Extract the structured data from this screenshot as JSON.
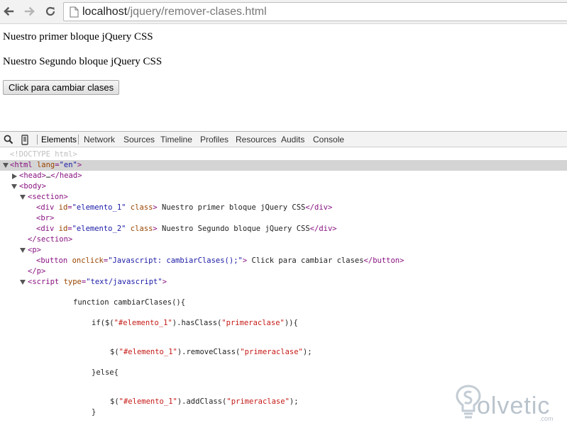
{
  "browser": {
    "url_host": "localhost",
    "url_path": "/jquery/remover-clases.html",
    "icons": [
      "back-icon",
      "forward-icon",
      "reload-icon",
      "page-icon"
    ]
  },
  "page": {
    "bloque_1": "Nuestro primer bloque jQuery CSS",
    "bloque_2": "Nuestro Segundo bloque jQuery CSS",
    "button_label": "Click para cambiar clases"
  },
  "devtools": {
    "icons": [
      "search-icon",
      "device-icon"
    ],
    "tabs": [
      "Elements",
      "Network",
      "Sources",
      "Timeline",
      "Profiles",
      "Resources",
      "Audits",
      "Console"
    ],
    "active_tab": "Elements"
  },
  "code": {
    "doctype": "<!DOCTYPE html>",
    "html_tag": "html",
    "html_attr": "lang",
    "html_val": "\"en\"",
    "head_open": "<head>",
    "head_ellipsis": "…",
    "head_close": "</head>",
    "body_open": "<body>",
    "section_open": "<section>",
    "div_tag": "div",
    "id_attr": "id",
    "class_attr": "class",
    "div1_id": "\"elemento_1\"",
    "div1_text": " Nuestro primer bloque jQuery CSS",
    "div_close": "</div>",
    "br": "<br>",
    "div2_id": "\"elemento_2\"",
    "div2_text": " Nuestro Segundo bloque jQuery CSS",
    "section_close": "</section>",
    "p_open": "<p>",
    "button_tag": "button",
    "onclick_attr": "onclick",
    "onclick_val": "\"Javascript: cambiarClases();\"",
    "button_text": " Click para cambiar clases",
    "button_close": "</button>",
    "p_close": "</p>",
    "script_tag": "script",
    "type_attr": "type",
    "type_val": "\"text/javascript\"",
    "js_function": "function cambiarClases(){",
    "js_if_pre": "if($(",
    "js_sel1": "\"#elemento_1\"",
    "js_if_mid": ").hasClass(",
    "js_cls": "\"primeraclase\"",
    "js_if_post": ")){",
    "js_remove_pre": "$(",
    "js_remove_mid": ").removeClass(",
    "js_remove_post": ");",
    "js_else": "}else{",
    "js_add_pre": "$(",
    "js_add_mid": ").addClass(",
    "js_add_post": ");",
    "js_close": "}"
  },
  "watermark": {
    "brand": "olvetic",
    "domain": ".com",
    "logo": "solvetic-logo"
  }
}
